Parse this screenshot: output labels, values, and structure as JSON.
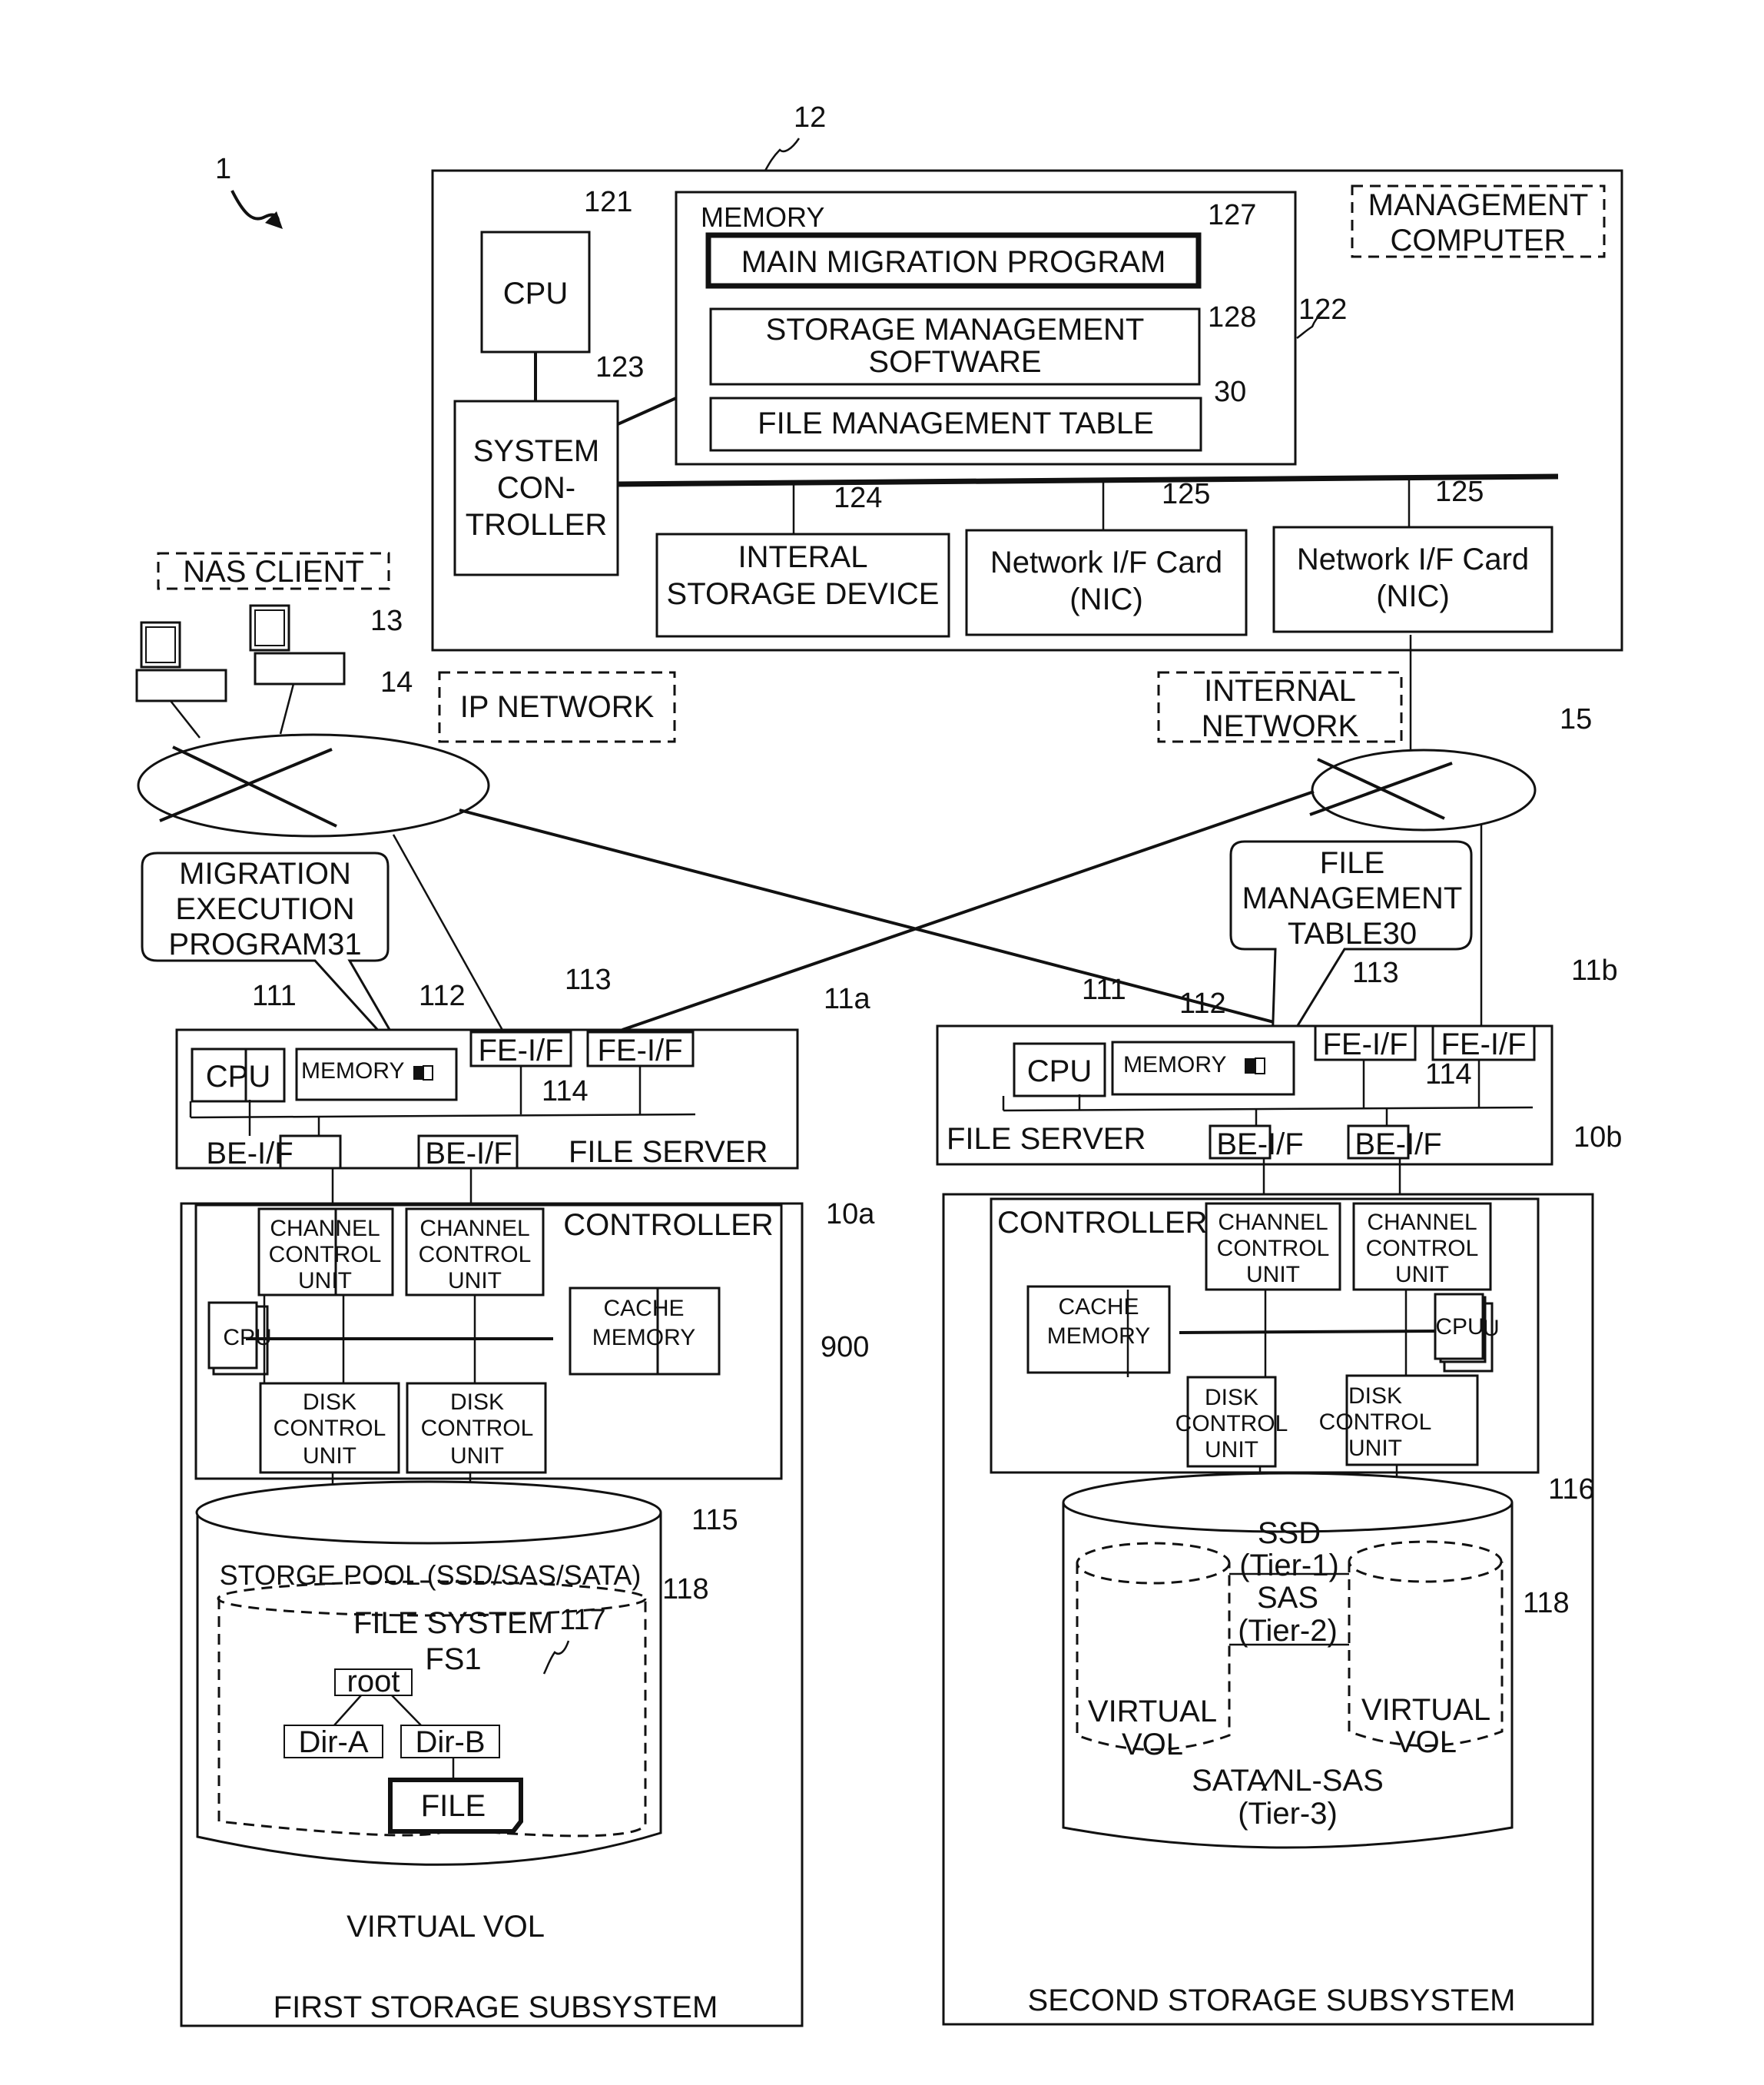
{
  "figure_ref": "1",
  "management_computer": {
    "ref": "12",
    "label": "MANAGEMENT COMPUTER",
    "label_lines": [
      "MANAGEMENT",
      "COMPUTER"
    ],
    "cpu": {
      "ref": "121",
      "label": "CPU"
    },
    "system_controller": {
      "ref": "123",
      "label_lines": [
        "SYSTEM",
        "CON-",
        "TROLLER"
      ]
    },
    "memory": {
      "ref": "122",
      "label": "MEMORY",
      "items": [
        {
          "ref": "127",
          "label_lines": [
            "MAIN MIGRATION PROGRAM"
          ]
        },
        {
          "ref": "128",
          "label_lines": [
            "STORAGE MANAGEMENT",
            "SOFTWARE"
          ]
        },
        {
          "ref": "30",
          "label_lines": [
            "FILE MANAGEMENT TABLE"
          ]
        }
      ]
    },
    "internal_storage": {
      "ref": "124",
      "label_lines": [
        "INTERAL",
        "STORAGE DEVICE"
      ]
    },
    "nics": [
      {
        "ref": "125",
        "label_lines": [
          "Network I/F Card",
          "(NIC)"
        ]
      },
      {
        "ref": "125",
        "label_lines": [
          "Network I/F Card",
          "(NIC)"
        ]
      }
    ]
  },
  "nas_client": {
    "ref": "13",
    "label": "NAS CLIENT"
  },
  "ip_network": {
    "ref": "14",
    "label": "IP NETWORK"
  },
  "internal_network": {
    "ref": "15",
    "label_lines": [
      "INTERNAL",
      "NETWORK"
    ]
  },
  "callouts": {
    "migration_execution": {
      "label_lines": [
        "MIGRATION",
        "EXECUTION",
        "PROGRAM31"
      ]
    },
    "file_management_table": {
      "label_lines": [
        "FILE",
        "MANAGEMENT",
        "TABLE30"
      ]
    }
  },
  "file_servers": [
    {
      "ref": "11a",
      "label": "FILE SERVER",
      "cpu": {
        "ref": "111",
        "label": "CPU"
      },
      "memory": {
        "ref": "112",
        "label": "MEMORY"
      },
      "fe_ref": "113",
      "fe_labels": [
        "FE-I/F",
        "FE-I/F"
      ],
      "be_ref": "114",
      "be_labels": [
        "BE-I/F",
        "BE-I/F"
      ]
    },
    {
      "ref": "11b",
      "label": "FILE SERVER",
      "cpu": {
        "ref": "111",
        "label": "CPU"
      },
      "memory": {
        "ref": "112",
        "label": "MEMORY"
      },
      "fe_ref": "113",
      "fe_labels": [
        "FE-I/F",
        "FE-I/F"
      ],
      "be_ref": "114",
      "be_labels": [
        "BE-I/F",
        "BE-I/F"
      ]
    }
  ],
  "storage_subsystems": [
    {
      "ref": "10a",
      "label": "FIRST STORAGE SUBSYSTEM",
      "controller": {
        "ref": "900",
        "label": "CONTROLLER",
        "channel_units": [
          [
            "CHANNEL",
            "CONTROL",
            "UNIT"
          ],
          [
            "CHANNEL",
            "CONTROL",
            "UNIT"
          ]
        ],
        "disk_units": [
          [
            "DISK",
            "CONTROL",
            "UNIT"
          ],
          [
            "DISK",
            "CONTROL",
            "UNIT"
          ]
        ],
        "cache": [
          "CACHE",
          "MEMORY"
        ],
        "cpu": "CPU"
      },
      "pool": {
        "ref": "115",
        "label": "STORGE POOL (SSD/SAS/SATA)"
      },
      "virtual_vol": {
        "ref": "118",
        "label": "VIRTUAL VOL"
      },
      "file_system": {
        "ref": "117",
        "label_lines": [
          "FILE SYSTEM",
          "FS1"
        ],
        "tree": {
          "root": "root",
          "dirs": [
            "Dir-A",
            "Dir-B"
          ],
          "file": "FILE"
        }
      }
    },
    {
      "ref": "10b",
      "label": "SECOND STORAGE SUBSYSTEM",
      "controller": {
        "label": "CONTROLLER",
        "channel_units": [
          [
            "CHANNEL",
            "CONTROL",
            "UNIT"
          ],
          [
            "CHANNEL",
            "CONTROL",
            "UNIT"
          ]
        ],
        "disk_units": [
          [
            "DISK",
            "CONTROL",
            "UNIT"
          ],
          [
            "DISK",
            "CONTROL",
            "UNIT"
          ]
        ],
        "cache": [
          "CACHE",
          "MEMORY"
        ],
        "cpu": "CPU"
      },
      "pool": {
        "ref": "116"
      },
      "virtual_vol_ref": "118",
      "virtual_vols": [
        [
          "VIRTUAL",
          "VOL"
        ],
        [
          "VIRTUAL",
          "VOL"
        ]
      ],
      "tiers": [
        {
          "label_lines": [
            "SSD",
            "(Tier-1)"
          ]
        },
        {
          "label_lines": [
            "SAS",
            "(Tier-2)"
          ]
        },
        {
          "label_lines": [
            "SATA∕NL-SAS",
            "(Tier-3)"
          ]
        }
      ]
    }
  ]
}
